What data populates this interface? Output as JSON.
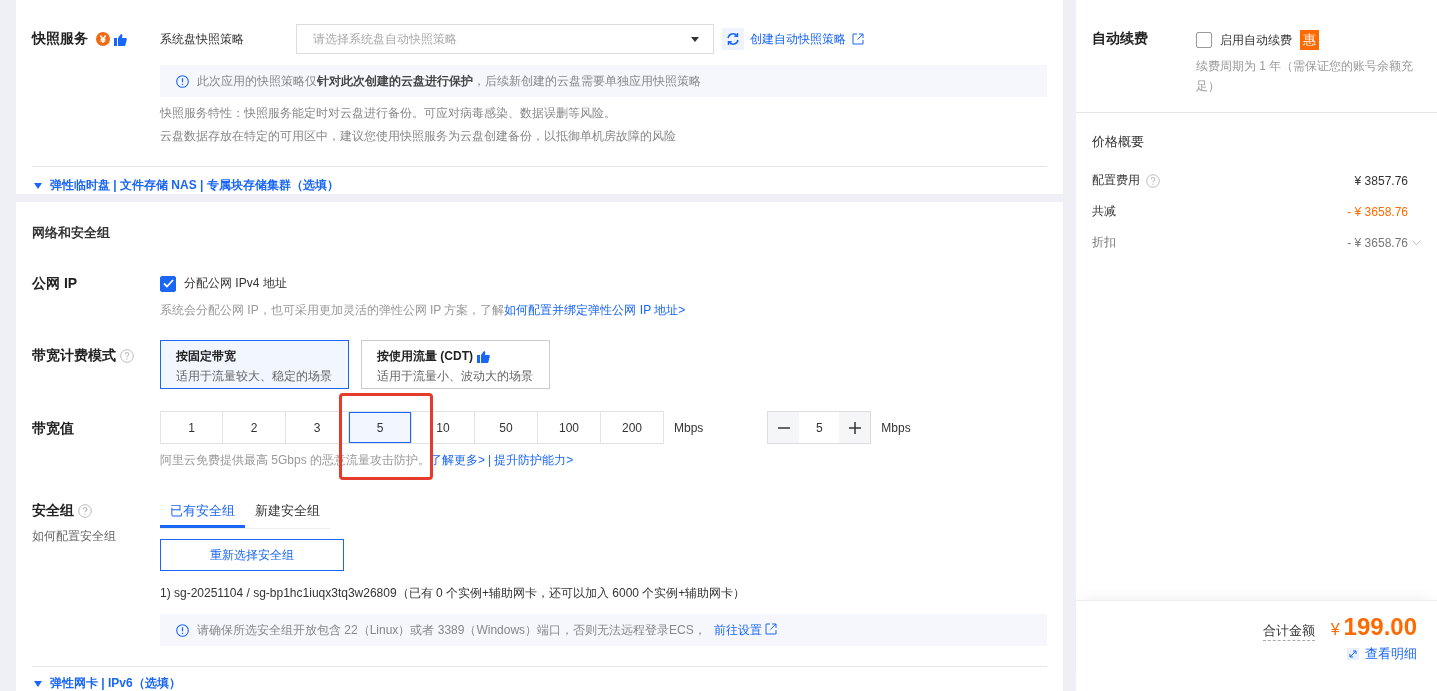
{
  "snapshot": {
    "label": "快照服务",
    "field_label": "系统盘快照策略",
    "placeholder": "请选择系统盘自动快照策略",
    "create_link": "创建自动快照策略",
    "notice": "此次应用的快照策略仅**针对此次创建的云盘进行保护**，后续新创建的云盘需要单独应用快照策略",
    "desc": [
      "快照服务特性：快照服务能定时对云盘进行备份。可应对病毒感染、数据误删等风险。",
      "云盘数据存放在特定的可用区中，建议您使用快照服务为云盘创建备份，以抵御单机房故障的风险"
    ]
  },
  "storage_toggle": {
    "label": "弹性临时盘 | 文件存储 NAS | 专属块存储集群（选填）",
    "expanded": false
  },
  "network": {
    "title": "网络和安全组",
    "public_ip": {
      "label": "公网 IP",
      "checkbox_label": "分配公网 IPv4 地址",
      "checked": true,
      "hint": "系统会分配公网 IP，也可采用更加灵活的弹性公网 IP 方案，了解",
      "hint_link": "如何配置并绑定弹性公网 IP 地址>"
    },
    "billing": {
      "label": "带宽计费模式",
      "options": [
        {
          "title": "按固定带宽",
          "desc": "适用于流量较大、稳定的场景",
          "selected": true,
          "recommended": false
        },
        {
          "title": "按使用流量 (CDT)",
          "desc": "适用于流量小、波动大的场景",
          "selected": false,
          "recommended": true
        }
      ]
    },
    "bandwidth": {
      "label": "带宽值",
      "options": [
        {
          "label": "1",
          "selected": false
        },
        {
          "label": "2",
          "selected": false
        },
        {
          "label": "3",
          "selected": false
        },
        {
          "label": "5",
          "selected": true
        },
        {
          "label": "10",
          "selected": false
        },
        {
          "label": "50",
          "selected": false
        },
        {
          "label": "100",
          "selected": false
        },
        {
          "label": "200",
          "selected": false
        }
      ],
      "unit": "Mbps",
      "stepper_value": "5",
      "stepper_unit": "Mbps",
      "hint": "阿里云免费提供最高 5Gbps 的恶意流量攻击防护。",
      "links": [
        "了解更多>",
        "提升防护能力>"
      ],
      "separator": "|"
    },
    "security": {
      "label": "安全组",
      "help_link": "如何配置安全组",
      "tabs": [
        {
          "label": "已有安全组",
          "selected": true
        },
        {
          "label": "新建安全组",
          "selected": false
        }
      ],
      "button": "重新选择安全组",
      "group": "1) sg-20251104 / sg-bp1hc1iuqx3tq3w26809（已有 0 个实例+辅助网卡，还可以加入 6000 个实例+辅助网卡）",
      "notice": "请确保所选安全组开放包含 22（Linux）或者 3389（Windows）端口，否则无法远程登录ECS，",
      "notice_link": "前往设置"
    },
    "eni_toggle": {
      "label": "弹性网卡 | IPv6（选填）",
      "expanded": false
    }
  },
  "sidebar": {
    "auto_renew": {
      "label": "自动续费",
      "checkbox_label": "启用自动续费",
      "checked": false,
      "badge": "惠",
      "hint": "续费周期为 1 年（需保证您的账号余额充足）"
    },
    "price": {
      "title": "价格概要",
      "rows": [
        {
          "label": "配置费用",
          "value": "¥ 3857.76",
          "kind": "help"
        },
        {
          "label": "共减",
          "value": "- ¥ 3658.76",
          "kind": "discount"
        },
        {
          "label": "折扣",
          "value": "- ¥ 3658.76",
          "kind": "expandable"
        }
      ]
    },
    "total": {
      "label": "合计金额",
      "currency": "¥",
      "amount": "199.00",
      "detail_link": "查看明细"
    }
  }
}
